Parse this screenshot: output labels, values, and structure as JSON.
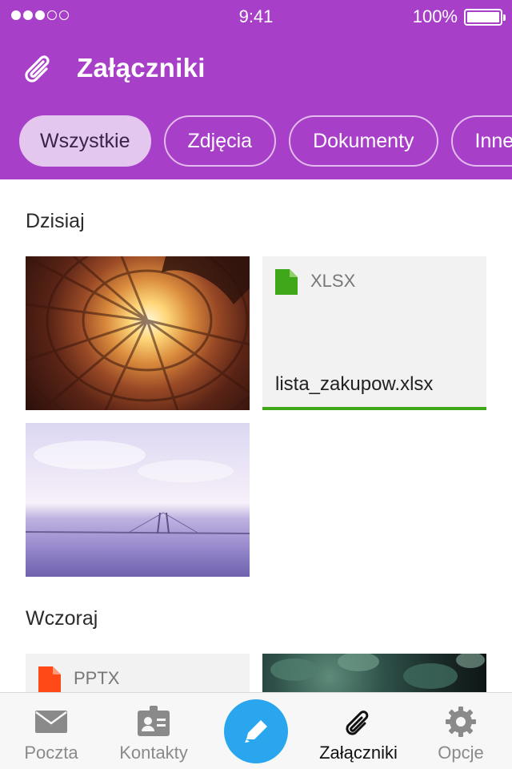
{
  "status": {
    "time": "9:41",
    "battery": "100%"
  },
  "header": {
    "title": "Załączniki"
  },
  "filters": [
    {
      "label": "Wszystkie",
      "active": true
    },
    {
      "label": "Zdjęcia",
      "active": false
    },
    {
      "label": "Dokumenty",
      "active": false
    },
    {
      "label": "Inne",
      "active": false
    }
  ],
  "sections": {
    "today": "Dzisiaj",
    "yesterday": "Wczoraj"
  },
  "files": {
    "xlsx": {
      "type": "XLSX",
      "name": "lista_zakupow.xlsx",
      "color": "#3fa71a"
    },
    "pptx": {
      "type": "PPTX",
      "color": "#ff4a17"
    }
  },
  "tabbar": {
    "mail": "Poczta",
    "contacts": "Kontakty",
    "attachments": "Załączniki",
    "options": "Opcje",
    "accent": "#2aa6ef"
  }
}
